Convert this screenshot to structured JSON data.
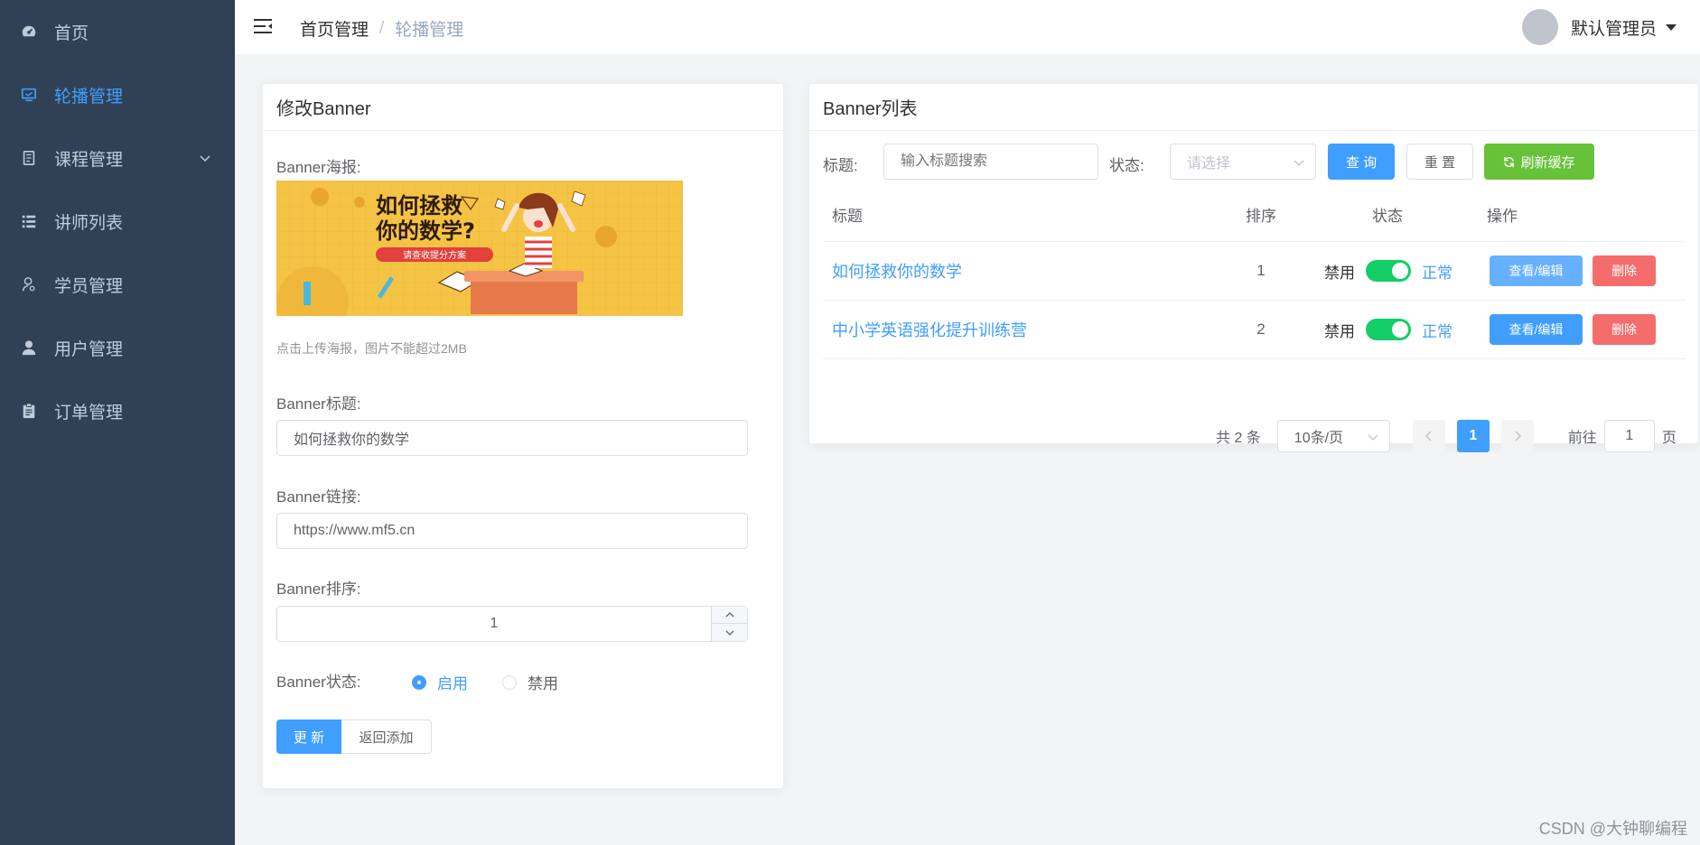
{
  "sidebar": {
    "items": [
      {
        "label": "首页",
        "icon": "dashboard-icon"
      },
      {
        "label": "轮播管理",
        "icon": "monitor-icon"
      },
      {
        "label": "课程管理",
        "icon": "book-icon"
      },
      {
        "label": "讲师列表",
        "icon": "list-icon"
      },
      {
        "label": "学员管理",
        "icon": "student-icon"
      },
      {
        "label": "用户管理",
        "icon": "user-icon"
      },
      {
        "label": "订单管理",
        "icon": "clipboard-icon"
      }
    ]
  },
  "header": {
    "breadcrumb_home": "首页管理",
    "breadcrumb_sep": "/",
    "breadcrumb_current": "轮播管理",
    "user_name": "默认管理员"
  },
  "edit": {
    "title": "修改Banner",
    "poster_label": "Banner海报:",
    "poster_headline": "如何拯救\n你的数学?",
    "poster_sub": "请查收提分方案",
    "upload_tip": "点击上传海报，图片不能超过2MB",
    "title_label": "Banner标题:",
    "title_value": "如何拯救你的数学",
    "link_label": "Banner链接:",
    "link_value": "https://www.mf5.cn",
    "sort_label": "Banner排序:",
    "sort_value": "1",
    "status_label": "Banner状态:",
    "status_enable": "启用",
    "status_disable": "禁用",
    "update_button": "更 新",
    "back_button": "返回添加"
  },
  "list": {
    "title": "Banner列表",
    "filter_title_label": "标题:",
    "filter_title_placeholder": "输入标题搜索",
    "filter_status_label": "状态:",
    "filter_status_placeholder": "请选择",
    "query_button": "查 询",
    "reset_button": "重 置",
    "refresh_button": "刷新缓存",
    "columns": [
      "标题",
      "排序",
      "状态",
      "操作"
    ],
    "rows": [
      {
        "title": "如何拯救你的数学",
        "sort": "1",
        "off_label": "禁用",
        "on_label": "正常",
        "edit": "查看/编辑",
        "delete": "删除"
      },
      {
        "title": "中小学英语强化提升训练营",
        "sort": "2",
        "off_label": "禁用",
        "on_label": "正常",
        "edit": "查看/编辑",
        "delete": "删除"
      }
    ],
    "pagination": {
      "total": "共 2 条",
      "page_size": "10条/页",
      "current_page": "1",
      "goto_prefix": "前往",
      "goto_value": "1",
      "goto_suffix": "页"
    }
  },
  "watermark": "CSDN @大钟聊编程",
  "colors": {
    "sidebar_bg": "#304156",
    "accent": "#409EFF",
    "success": "#67c23a",
    "danger": "#f56c6c",
    "switch_on": "#13ce66"
  }
}
